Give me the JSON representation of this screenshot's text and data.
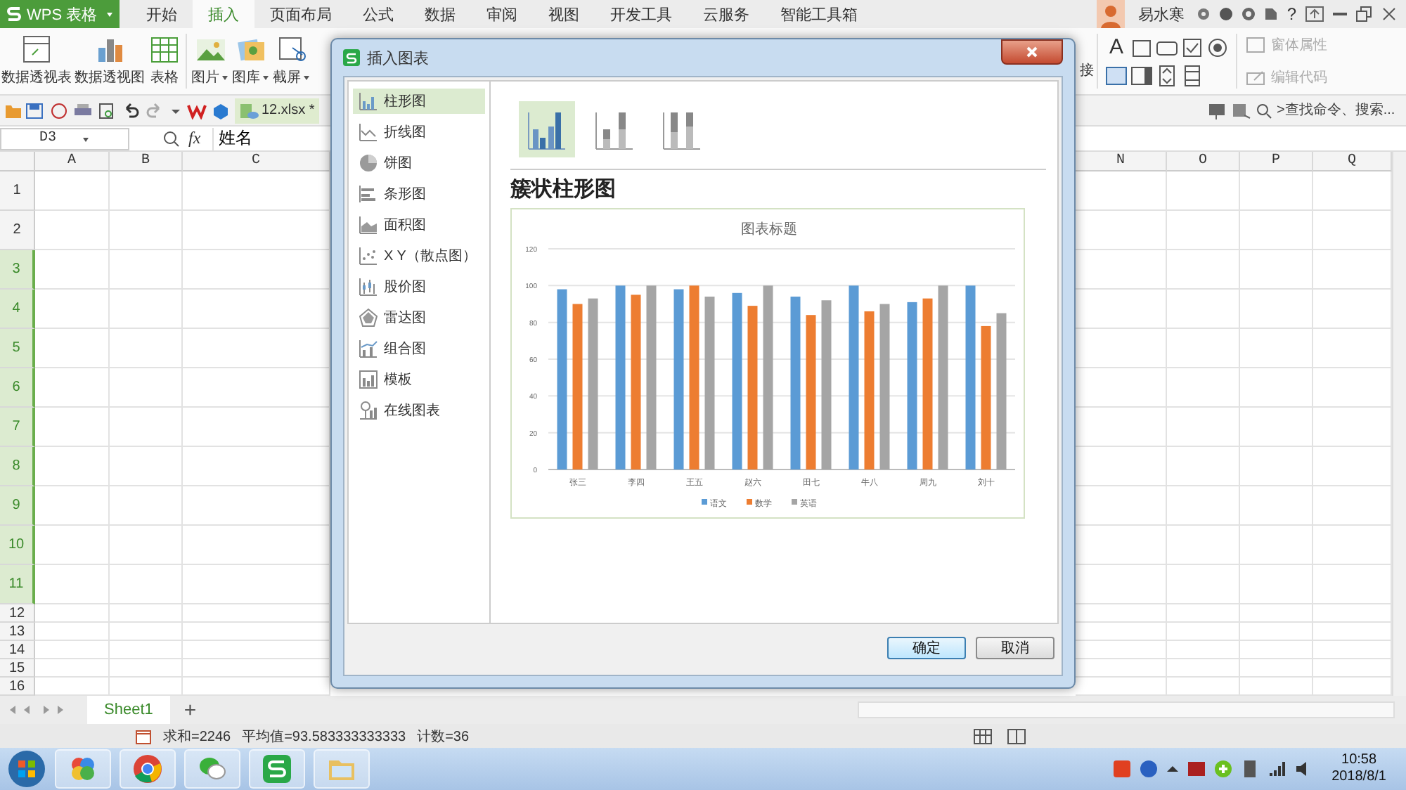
{
  "app": {
    "logo_label": "WPS 表格"
  },
  "menu_tabs": [
    {
      "label": "开始",
      "selected": false
    },
    {
      "label": "插入",
      "selected": true
    },
    {
      "label": "页面布局",
      "selected": false
    },
    {
      "label": "公式",
      "selected": false
    },
    {
      "label": "数据",
      "selected": false
    },
    {
      "label": "审阅",
      "selected": false
    },
    {
      "label": "视图",
      "selected": false
    },
    {
      "label": "开发工具",
      "selected": false
    },
    {
      "label": "云服务",
      "selected": false
    },
    {
      "label": "智能工具箱",
      "selected": false
    }
  ],
  "user": {
    "name": "易水寒",
    "help_label": "?"
  },
  "ribbon": {
    "left_buttons": [
      {
        "label": "数据透视表",
        "menu": false
      },
      {
        "label": "数据透视图",
        "menu": false
      },
      {
        "label": "表格",
        "menu": false
      },
      {
        "label": "图片",
        "menu": true
      },
      {
        "label": "图库",
        "menu": true
      },
      {
        "label": "截屏",
        "menu": true
      }
    ],
    "partial_label": "接",
    "control_glyph": "A",
    "right_commands": [
      {
        "label": "窗体属性",
        "disabled": true
      },
      {
        "label": "编辑代码",
        "disabled": true
      }
    ]
  },
  "file_tab": {
    "label": "12.xlsx *"
  },
  "search": {
    "placeholder": ">查找命令、搜索..."
  },
  "formula_bar": {
    "cell_ref": "D3",
    "fx": "fx",
    "value": "姓名"
  },
  "columns": [
    {
      "label": "A"
    },
    {
      "label": "B"
    },
    {
      "label": "C"
    },
    {
      "label": "N"
    },
    {
      "label": "O"
    },
    {
      "label": "P"
    },
    {
      "label": "Q"
    }
  ],
  "rows": [
    {
      "label": "1",
      "selected": false
    },
    {
      "label": "2",
      "selected": false
    },
    {
      "label": "3",
      "selected": true
    },
    {
      "label": "4",
      "selected": true
    },
    {
      "label": "5",
      "selected": true
    },
    {
      "label": "6",
      "selected": true
    },
    {
      "label": "7",
      "selected": true
    },
    {
      "label": "8",
      "selected": true
    },
    {
      "label": "9",
      "selected": true
    },
    {
      "label": "10",
      "selected": true
    },
    {
      "label": "11",
      "selected": true
    },
    {
      "label": "12",
      "selected": false
    },
    {
      "label": "13",
      "selected": false
    },
    {
      "label": "14",
      "selected": false
    },
    {
      "label": "15",
      "selected": false
    },
    {
      "label": "16",
      "selected": false
    }
  ],
  "sheet_tabs": [
    {
      "label": "Sheet1",
      "selected": true
    }
  ],
  "add_sheet_label": "+",
  "status_bar": {
    "sum": "求和=2246",
    "average": "平均值=93.583333333333",
    "count": "计数=36"
  },
  "dialog": {
    "title": "插入图表",
    "chart_types": [
      {
        "label": "柱形图",
        "selected": true
      },
      {
        "label": "折线图",
        "selected": false
      },
      {
        "label": "饼图",
        "selected": false
      },
      {
        "label": "条形图",
        "selected": false
      },
      {
        "label": "面积图",
        "selected": false
      },
      {
        "label": "X Y（散点图）",
        "selected": false
      },
      {
        "label": "股价图",
        "selected": false
      },
      {
        "label": "雷达图",
        "selected": false
      },
      {
        "label": "组合图",
        "selected": false
      },
      {
        "label": "模板",
        "selected": false
      },
      {
        "label": "在线图表",
        "selected": false
      }
    ],
    "subtypes": [
      {
        "selected": true
      },
      {
        "selected": false
      },
      {
        "selected": false
      }
    ],
    "subtype_title": "簇状柱形图",
    "chart_data": {
      "type": "bar",
      "title": "图表标题",
      "categories": [
        "张三",
        "李四",
        "王五",
        "赵六",
        "田七",
        "牛八",
        "周九",
        "刘十"
      ],
      "series": [
        {
          "name": "语文",
          "color": "#5b9bd5",
          "values": [
            98,
            100,
            98,
            96,
            94,
            100,
            91,
            100
          ]
        },
        {
          "name": "数学",
          "color": "#ed7d31",
          "values": [
            90,
            95,
            100,
            89,
            84,
            86,
            93,
            78
          ]
        },
        {
          "name": "英语",
          "color": "#a5a5a5",
          "values": [
            93,
            100,
            94,
            100,
            92,
            90,
            100,
            85
          ]
        }
      ],
      "ylim": [
        0,
        120
      ],
      "yticks": [
        0,
        20,
        40,
        60,
        80,
        100,
        120
      ],
      "grid": true,
      "legend": true
    },
    "buttons": [
      {
        "label": "确定",
        "default": true
      },
      {
        "label": "取消",
        "default": false
      }
    ]
  },
  "clock": {
    "time": "10:58",
    "date": "2018/8/1"
  }
}
